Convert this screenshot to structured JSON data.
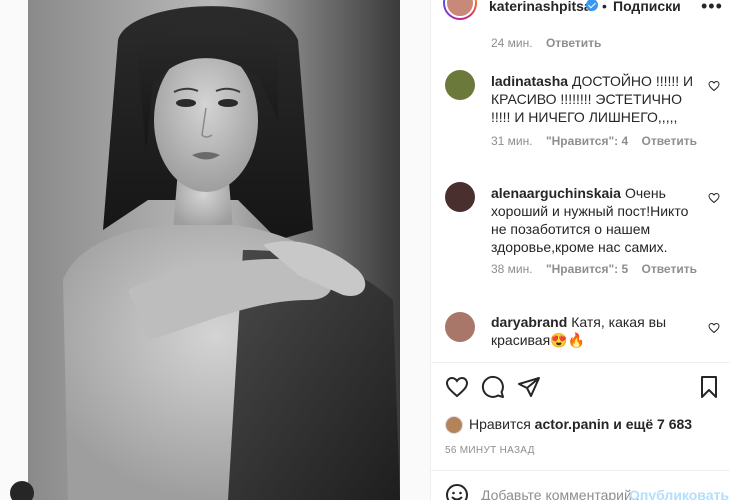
{
  "post": {
    "author": "katerinashpitsa",
    "follow_label": "Подписки",
    "dot": "•"
  },
  "comments": [
    {
      "username": "",
      "text": "",
      "time": "24 мин.",
      "likes": "",
      "reply": "Ответить"
    },
    {
      "username": "ladinatasha",
      "text": "ДОСТОЙНО !!!!!! И КРАСИВО !!!!!!!! ЭСТЕТИЧНО !!!!! И НИЧЕГО ЛИШНЕГО,,,,,",
      "time": "31 мин.",
      "likes": "\"Нравится\": 4",
      "reply": "Ответить",
      "avatar_color": "#6b7a3a"
    },
    {
      "username": "alenaarguchinskaia",
      "text": "Очень хороший и нужный пост!Никто не позаботится о нашем здоровье,кроме нас самих.",
      "time": "38 мин.",
      "likes": "\"Нравится\": 5",
      "reply": "Ответить",
      "avatar_color": "#4a2f2f"
    },
    {
      "username": "daryabrand",
      "text": "Катя, какая вы красивая😍🔥",
      "time": "",
      "likes": "",
      "reply": "",
      "avatar_color": "#a8776a"
    }
  ],
  "likes": {
    "prefix": "Нравится",
    "user": "actor.panin",
    "suffix": "и ещё 7 683"
  },
  "time_ago": "56 МИНУТ НАЗАД",
  "add_comment": {
    "placeholder": "Добавьте комментарий...",
    "publish_label": "Опубликовать"
  },
  "icons": {
    "like": "heart-icon",
    "comment": "comment-icon",
    "share": "paper-plane-icon",
    "save": "bookmark-icon",
    "emoji": "emoji-icon",
    "more": "more-icon",
    "verified": "verified-badge-icon"
  },
  "colors": {
    "accent": "#3897f0",
    "publish_disabled": "#b2dffc",
    "muted": "#8e8e8e"
  }
}
